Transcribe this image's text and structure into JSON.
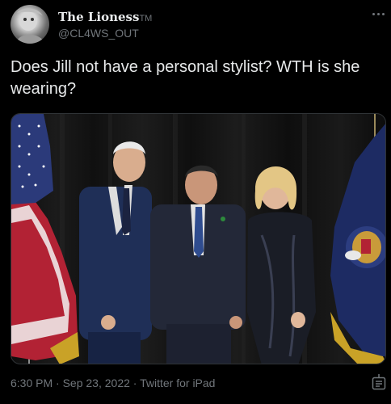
{
  "tweet": {
    "author": {
      "display_name": "The Lioness",
      "display_name_suffix": "TM",
      "handle": "@CL4WS_OUT"
    },
    "text": "Does Jill not have a personal stylist? WTH is she wearing?",
    "time": "6:30 PM",
    "separator": "·",
    "date": "Sep 23, 2022",
    "source": "Twitter for iPad"
  },
  "icons": {
    "more": "more-horizontal-icon",
    "share": "share-icon"
  }
}
